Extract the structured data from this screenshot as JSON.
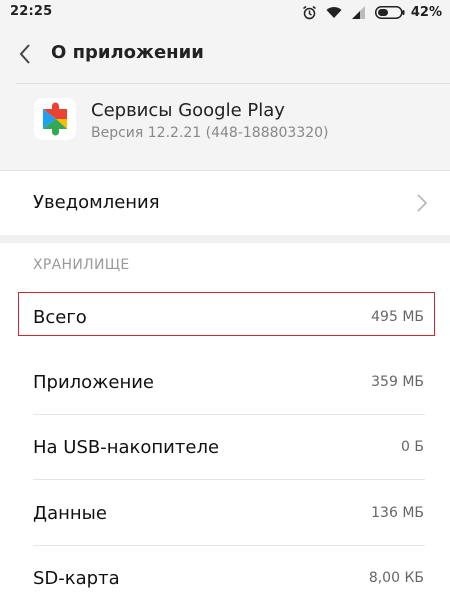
{
  "status_bar": {
    "time": "22:25",
    "icons": [
      "alarm-icon",
      "wifi-icon",
      "signal-icon",
      "battery-icon"
    ],
    "battery_percent": "42%"
  },
  "header": {
    "title": "О приложении",
    "back_icon": "back-arrow-icon"
  },
  "app": {
    "name": "Сервисы Google Play",
    "version": "Версия 12.2.21 (448-188803320)",
    "icon": "google-play-services-icon"
  },
  "notifications": {
    "label": "Уведомления",
    "icon": "chevron-right-icon"
  },
  "storage": {
    "section_title": "ХРАНИЛИЩЕ",
    "rows": [
      {
        "label": "Всего",
        "value": "495 МБ",
        "highlighted": true
      },
      {
        "label": "Приложение",
        "value": "359 МБ"
      },
      {
        "label": "На USB-накопителе",
        "value": "0 Б"
      },
      {
        "label": "Данные",
        "value": "136 МБ"
      },
      {
        "label": "SD-карта",
        "value": "8,00 КБ"
      }
    ]
  },
  "colors": {
    "highlight_border": "#cc2a33",
    "header_background": "#f4f4f4"
  }
}
